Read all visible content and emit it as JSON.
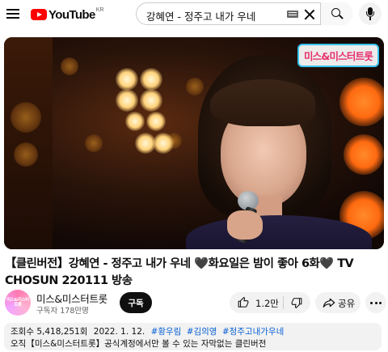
{
  "header": {
    "logo_text": "YouTube",
    "country_code": "KR",
    "search_value": "강혜연 - 정주고 내가 우네"
  },
  "video": {
    "watermark": "미스&미스터트롯"
  },
  "title": "【클린버전】강혜연 - 정주고 내가 우네 🖤화요일은 밤이 좋아 6화🖤 TV CHOSUN 220111 방송",
  "channel": {
    "avatar_text": "미스&미스터트롯",
    "name": "미스&미스터트롯",
    "subscribers": "구독자 178만명",
    "subscribe_label": "구독"
  },
  "actions": {
    "like_count": "1.2만",
    "share_label": "공유"
  },
  "description": {
    "views": "조회수 5,418,251회",
    "date": "2022. 1. 12.",
    "tags": [
      "#황우림",
      "#김의영",
      "#정주고내가우네"
    ],
    "text": "오직【미스&미스터트롯】공식계정에서만 볼 수 있는 자막없는 클린버전"
  },
  "colors": {
    "brand_red": "#ff0000",
    "link_blue": "#065fd4",
    "chip_bg": "#f2f2f2"
  }
}
